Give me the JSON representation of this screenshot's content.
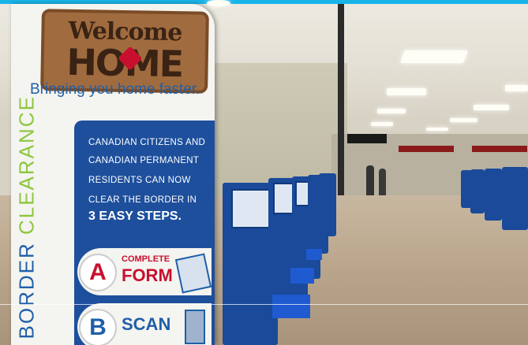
{
  "banner": {
    "mat_line1": "Welcome",
    "mat_line2": "HOME",
    "tagline": "Bringing you home faster.",
    "vertical_word1": "BORDER",
    "vertical_word2": "CLEARANCE",
    "info_lines": [
      "CANADIAN CITIZENS AND",
      "CANADIAN PERMANENT",
      "RESIDENTS CAN NOW",
      "CLEAR THE BORDER IN"
    ],
    "steps_headline": "3 EASY STEPS.",
    "step_a": {
      "letter": "A",
      "line1": "COMPLETE",
      "line2": "FORM"
    },
    "step_b": {
      "letter": "B",
      "line2": "SCAN"
    }
  },
  "colors": {
    "brand_blue": "#1d4f9c",
    "accent_red": "#c8102e",
    "accent_green": "#8dc63f",
    "top_bar": "#18b4e8"
  }
}
